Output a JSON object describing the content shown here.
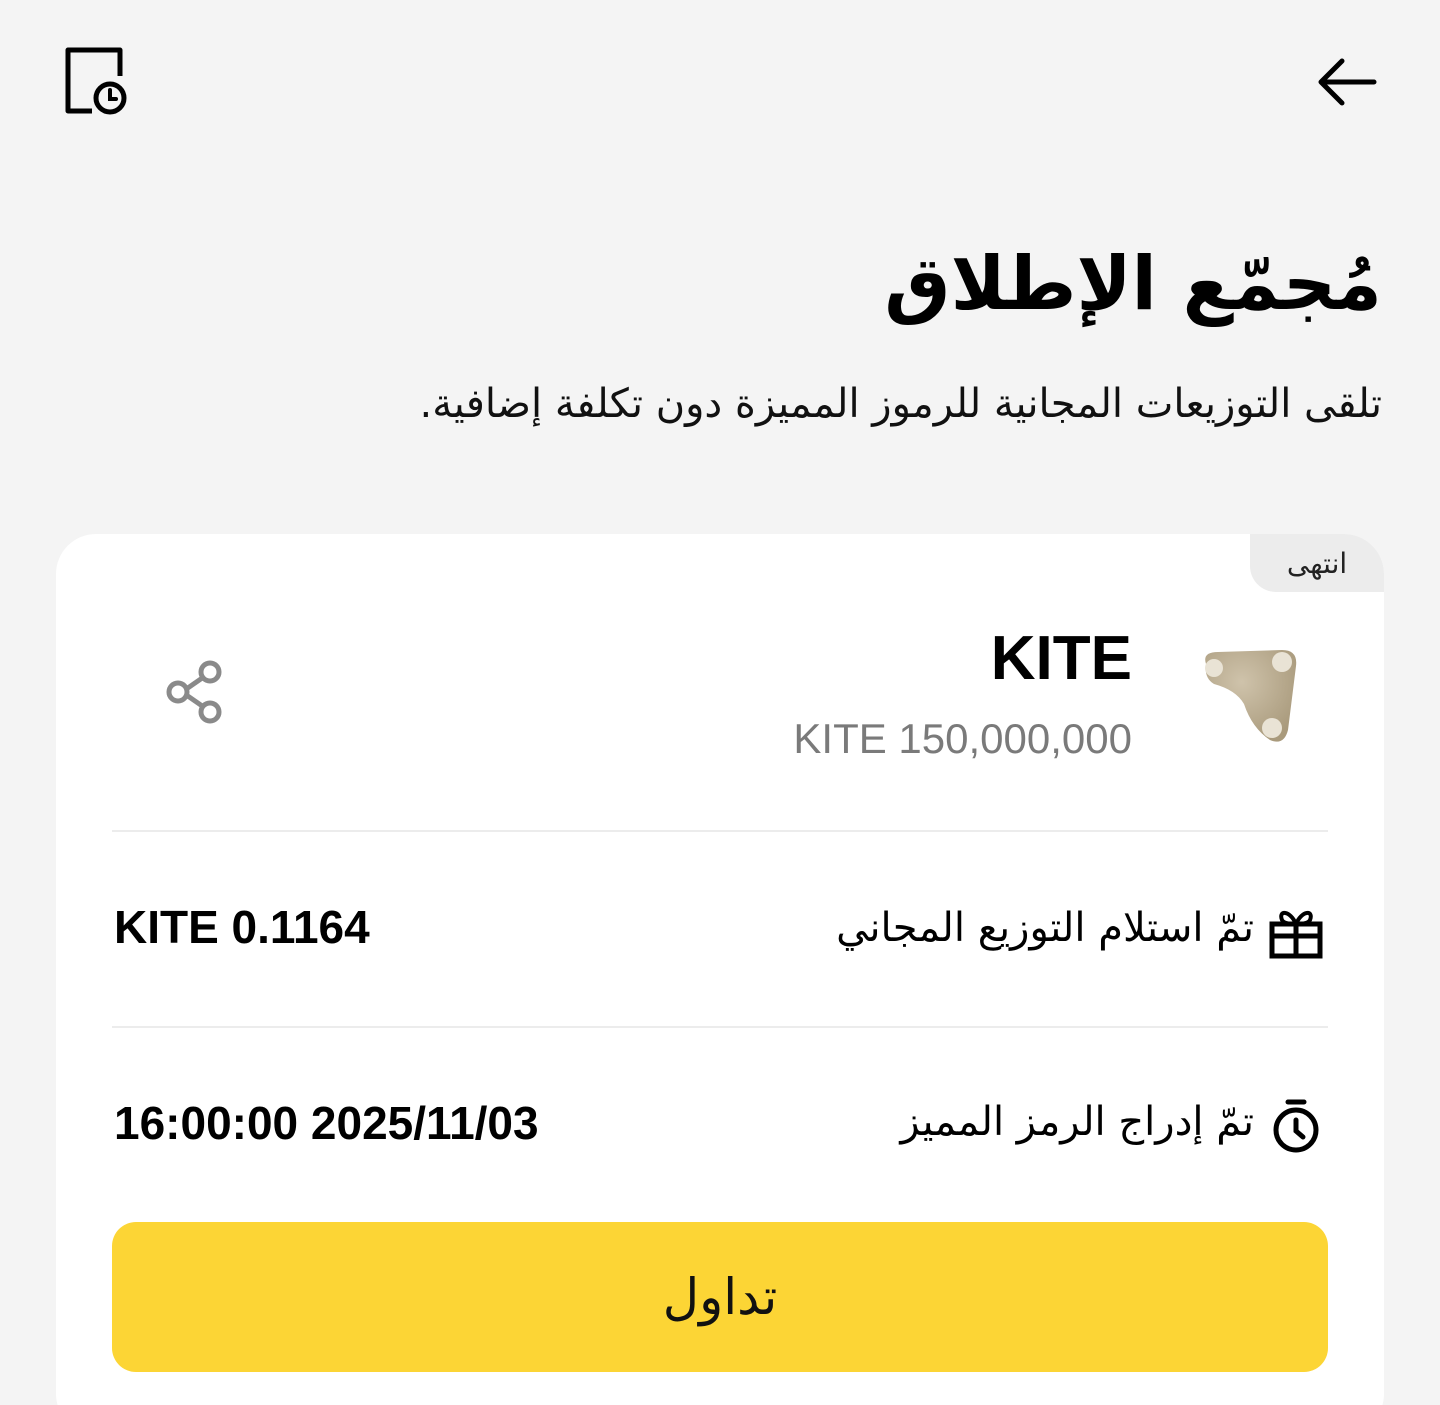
{
  "header": {
    "title": "مُجمّع الإطلاق",
    "subtitle": "تلقى التوزيعات المجانية للرموز المميزة دون تكلفة إضافية.",
    "back_icon": "arrow-left-icon",
    "history_icon": "document-clock-icon"
  },
  "card": {
    "status": "انتهى",
    "token": {
      "name": "KITE",
      "total_amount": "KITE 150,000,000",
      "logo_color": "#bdb19a"
    },
    "share_icon": "share-icon",
    "rows": [
      {
        "icon": "gift-icon",
        "label": "تمّ استلام التوزيع المجاني",
        "value": "KITE 0.1164"
      },
      {
        "icon": "stopwatch-icon",
        "label": "تمّ إدراج الرمز المميز",
        "value": "16:00:00 2025/11/03"
      }
    ],
    "trade_label": "تداول"
  },
  "colors": {
    "background": "#f4f4f4",
    "card": "#ffffff",
    "accent": "#fcd535",
    "muted_text": "#7a7a7a"
  }
}
